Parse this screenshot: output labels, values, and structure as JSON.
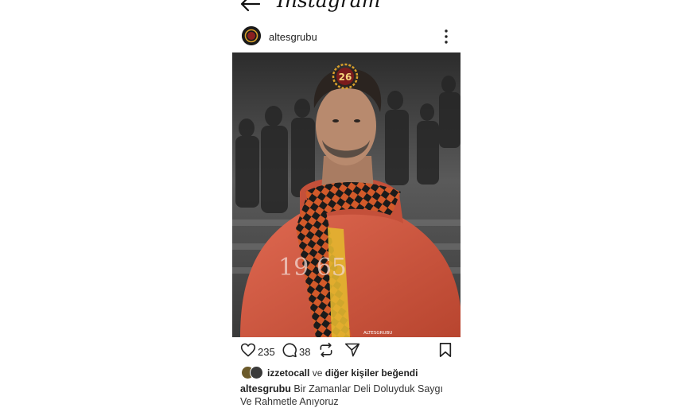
{
  "app": {
    "logo_text": "Instagram"
  },
  "post": {
    "username": "altesgrubu",
    "image": {
      "badge_number": "26",
      "sweater_text": "19 65",
      "footer_text": "ALTESGRUBU"
    },
    "likes_count": "235",
    "comments_count": "38",
    "liked_by": {
      "user": "izzetocall",
      "connector": "ve",
      "others": "diğer kişiler beğendi"
    },
    "caption": {
      "user": "altesgrubu",
      "text": "Bir Zamanlar Deli Doluyduk Saygı Ve Rahmetle Anıyoruz"
    }
  },
  "colors": {
    "hoodie": "#d55843",
    "scarf_orange": "#d25a2a",
    "scarf_dark": "#1b1b1b",
    "badge_gold": "#d9a02b"
  }
}
